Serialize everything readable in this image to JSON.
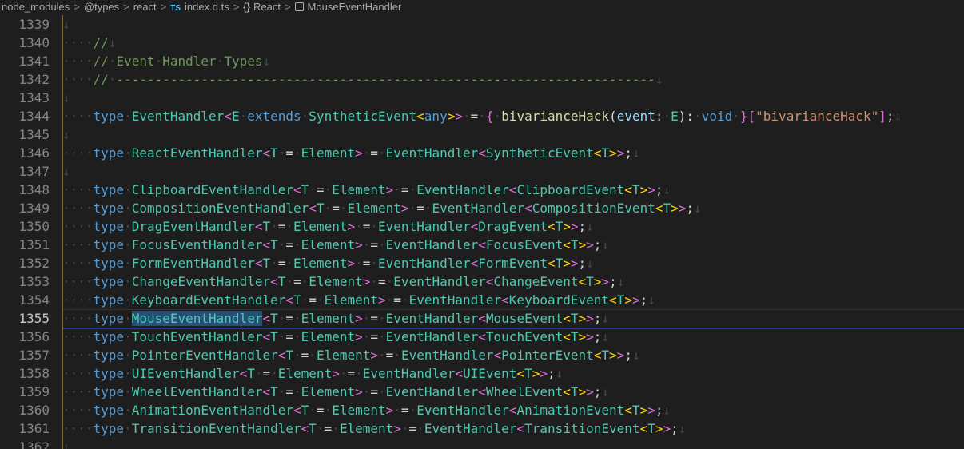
{
  "breadcrumb": {
    "items": [
      "node_modules",
      "@types",
      "react",
      "index.d.ts",
      "React",
      "MouseEventHandler"
    ],
    "separator": ">",
    "file_badge": "TS",
    "namespace_icon": "{}"
  },
  "editor": {
    "current_line": "1355",
    "whitespace_dot": "·",
    "eol_mark": "↓",
    "lines": [
      {
        "n": "1339",
        "t": ""
      },
      {
        "n": "1340",
        "t": "//"
      },
      {
        "n": "1341",
        "t": "// Event Handler Types"
      },
      {
        "n": "1342",
        "t": "// ----------------------------------------------------------------------"
      },
      {
        "n": "1343",
        "t": ""
      },
      {
        "n": "1344",
        "t": "type EventHandler<E extends SyntheticEvent<any>> = { bivarianceHack(event: E): void }[\"bivarianceHack\"];"
      },
      {
        "n": "1345",
        "t": ""
      },
      {
        "n": "1346",
        "t": "type ReactEventHandler<T = Element> = EventHandler<SyntheticEvent<T>>;"
      },
      {
        "n": "1347",
        "t": ""
      },
      {
        "n": "1348",
        "t": "type ClipboardEventHandler<T = Element> = EventHandler<ClipboardEvent<T>>;"
      },
      {
        "n": "1349",
        "t": "type CompositionEventHandler<T = Element> = EventHandler<CompositionEvent<T>>;"
      },
      {
        "n": "1350",
        "t": "type DragEventHandler<T = Element> = EventHandler<DragEvent<T>>;"
      },
      {
        "n": "1351",
        "t": "type FocusEventHandler<T = Element> = EventHandler<FocusEvent<T>>;"
      },
      {
        "n": "1352",
        "t": "type FormEventHandler<T = Element> = EventHandler<FormEvent<T>>;"
      },
      {
        "n": "1353",
        "t": "type ChangeEventHandler<T = Element> = EventHandler<ChangeEvent<T>>;"
      },
      {
        "n": "1354",
        "t": "type KeyboardEventHandler<T = Element> = EventHandler<KeyboardEvent<T>>;"
      },
      {
        "n": "1355",
        "t": "type MouseEventHandler<T = Element> = EventHandler<MouseEvent<T>>;"
      },
      {
        "n": "1356",
        "t": "type TouchEventHandler<T = Element> = EventHandler<TouchEvent<T>>;"
      },
      {
        "n": "1357",
        "t": "type PointerEventHandler<T = Element> = EventHandler<PointerEvent<T>>;"
      },
      {
        "n": "1358",
        "t": "type UIEventHandler<T = Element> = EventHandler<UIEvent<T>>;"
      },
      {
        "n": "1359",
        "t": "type WheelEventHandler<T = Element> = EventHandler<WheelEvent<T>>;"
      },
      {
        "n": "1360",
        "t": "type AnimationEventHandler<T = Element> = EventHandler<AnimationEvent<T>>;"
      },
      {
        "n": "1361",
        "t": "type TransitionEventHandler<T = Element> = EventHandler<TransitionEvent<T>>;"
      },
      {
        "n": "1362",
        "t": ""
      }
    ]
  }
}
